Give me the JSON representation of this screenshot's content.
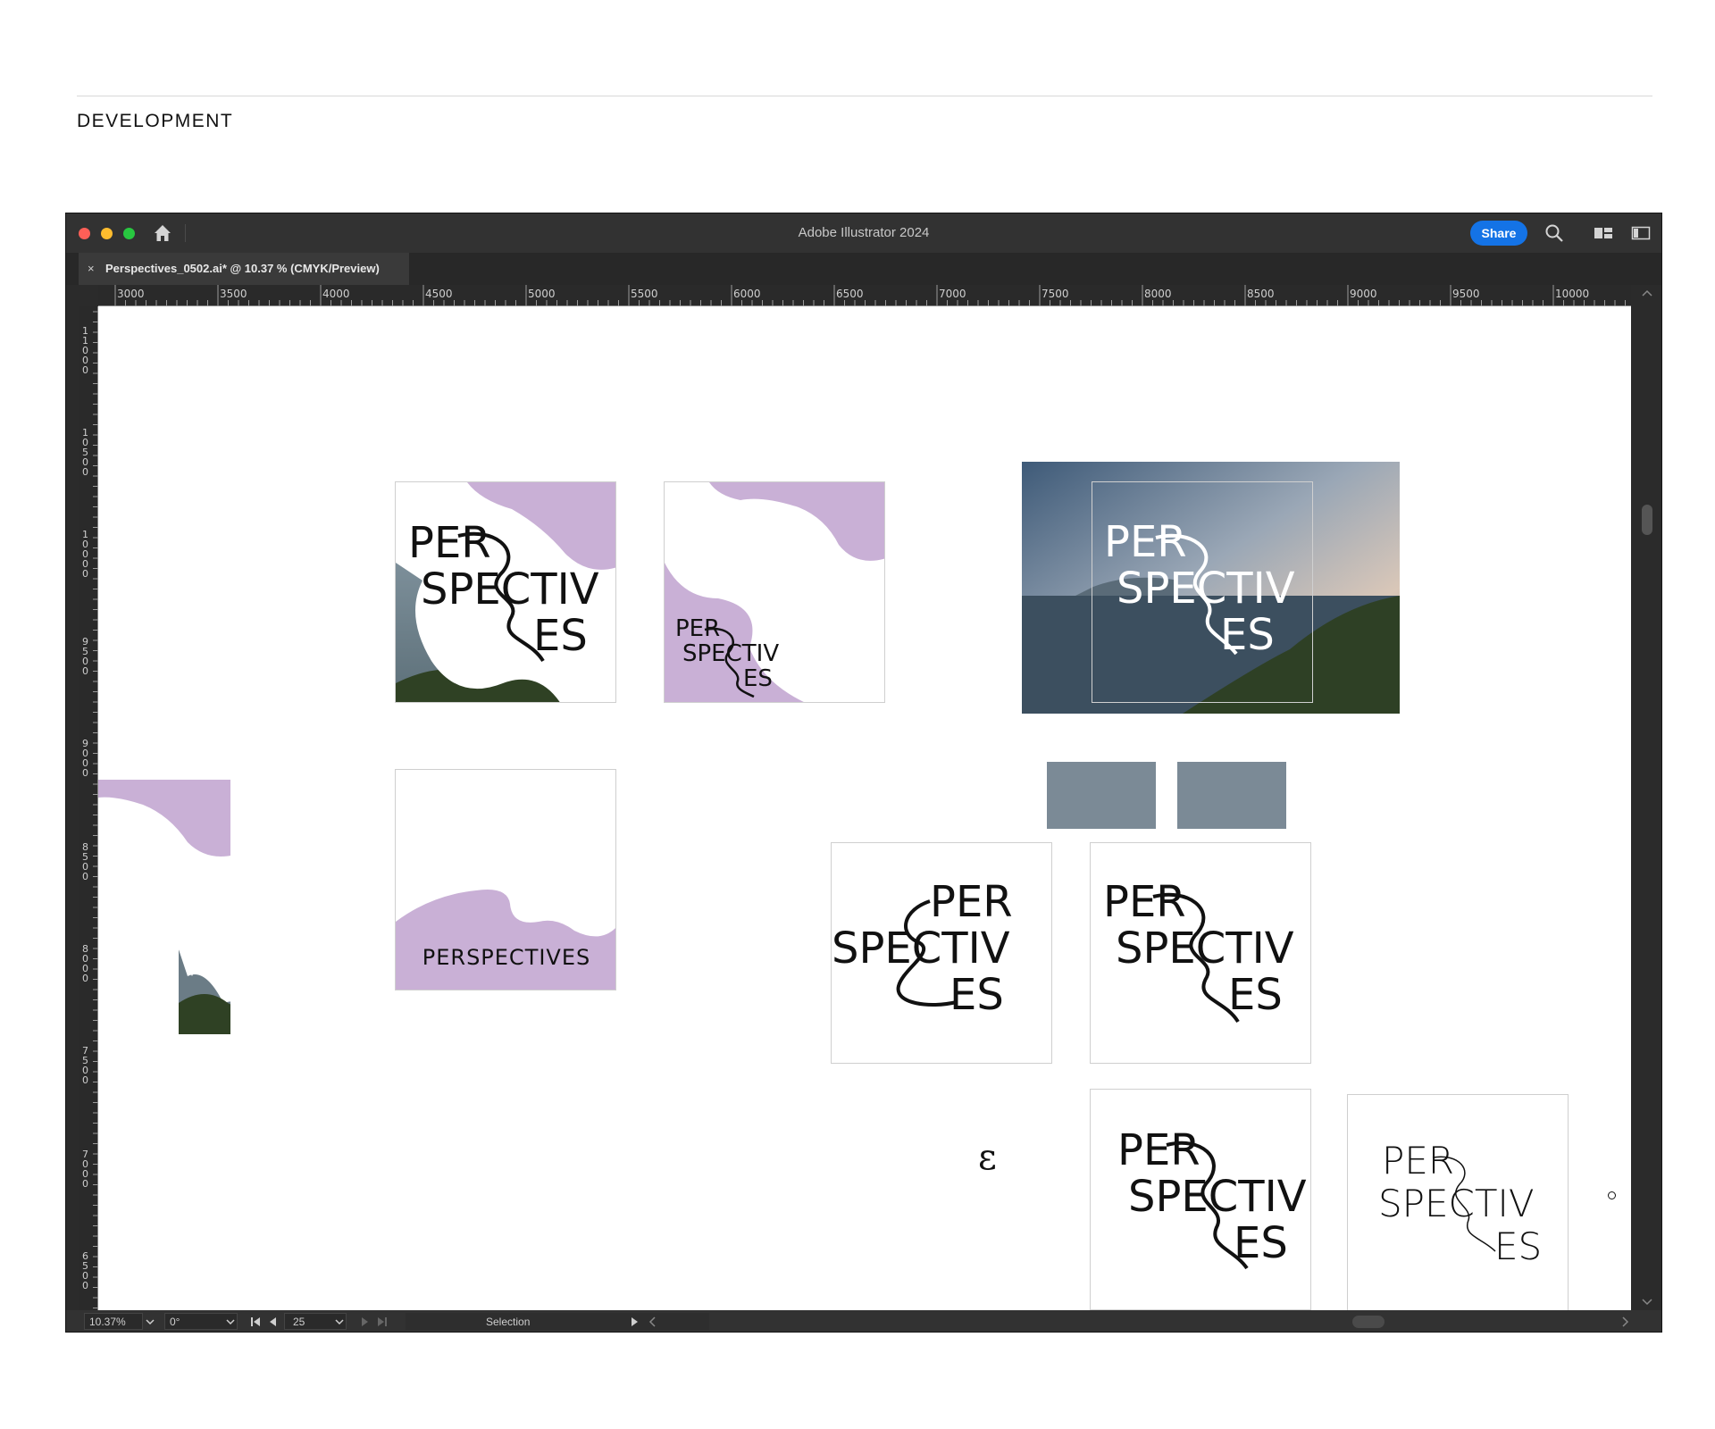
{
  "page": {
    "heading": "DEVELOPMENT"
  },
  "window": {
    "app_title": "Adobe Illustrator 2024",
    "share_label": "Share",
    "doc_tab": {
      "close_glyph": "×",
      "name": "Perspectives_0502.ai* @ 10.37 % (CMYK/Preview)"
    }
  },
  "rulers": {
    "horizontal": [
      "3000",
      "3500",
      "4000",
      "4500",
      "5000",
      "5500",
      "6000",
      "6500",
      "7000",
      "7500",
      "8000",
      "8500",
      "9000",
      "9500",
      "10000"
    ],
    "vertical": [
      "11000",
      "10500",
      "10000",
      "9500",
      "9000",
      "8500",
      "8000",
      "7500",
      "7000",
      "6500"
    ]
  },
  "statusbar": {
    "zoom": "10.37%",
    "rotation": "0°",
    "artboard_number": "25",
    "tool": "Selection"
  },
  "artboards": {
    "logo_words": [
      "PER",
      "SPECTIV",
      "ES"
    ],
    "wordmark": "PERSPECTIVES",
    "stray_glyph": "ε"
  },
  "colors": {
    "lilac": "#c9b0d6",
    "share_blue": "#1473e6",
    "slate_gray": "#7b8a96"
  }
}
